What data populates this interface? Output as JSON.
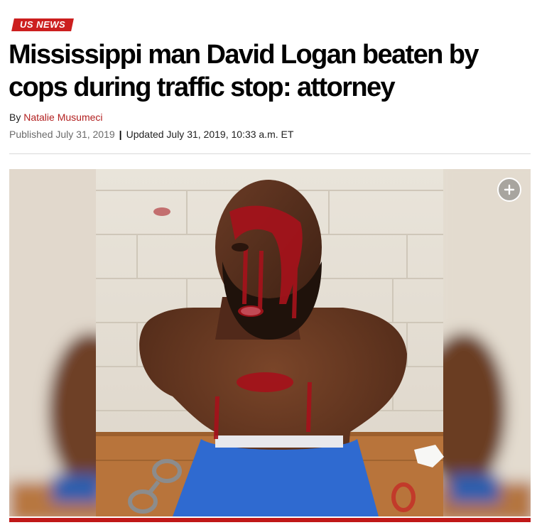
{
  "section": {
    "label": "US NEWS",
    "color": "#cc1f1f"
  },
  "article": {
    "headline": "Mississippi man David Logan beaten by cops during traffic stop: attorney",
    "byline_prefix": "By",
    "author": "Natalie Musumeci",
    "published": "Published July 31, 2019",
    "separator": "|",
    "updated": "Updated July 31, 2019, 10:33 a.m. ET"
  },
  "photo": {
    "expand_icon": "plus-circle-icon"
  }
}
